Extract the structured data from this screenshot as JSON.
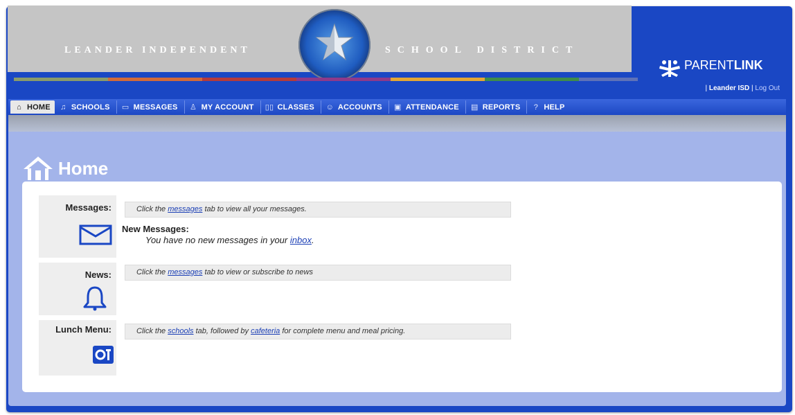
{
  "banner": {
    "left_text": "Leander Independent",
    "right_text": "School District"
  },
  "brand": {
    "name_light": "PARENT",
    "name_bold": "LINK"
  },
  "top_links": {
    "sep": "|",
    "district": "Leander ISD",
    "logout": "Log Out"
  },
  "nav": {
    "tabs": [
      {
        "label": "HOME",
        "icon": "home-icon"
      },
      {
        "label": "SCHOOLS",
        "icon": "bell-icon"
      },
      {
        "label": "MESSAGES",
        "icon": "envelope-icon"
      },
      {
        "label": "MY ACCOUNT",
        "icon": "person-icon"
      },
      {
        "label": "CLASSES",
        "icon": "book-icon"
      },
      {
        "label": "ACCOUNTS",
        "icon": "people-icon"
      },
      {
        "label": "ATTENDANCE",
        "icon": "calendar-icon"
      },
      {
        "label": "REPORTS",
        "icon": "report-icon"
      },
      {
        "label": "HELP",
        "icon": "help-icon"
      }
    ]
  },
  "page": {
    "title": "Home"
  },
  "sections": {
    "messages": {
      "label": "Messages:",
      "hint_pre": "Click the ",
      "hint_link": "messages",
      "hint_post": " tab to view all your messages.",
      "new_title": "New Messages:",
      "new_pre": "You have no new messages in your ",
      "new_link": "inbox",
      "new_post": "."
    },
    "news": {
      "label": "News:",
      "hint_pre": "Click the ",
      "hint_link": "messages",
      "hint_post": " tab to view or subscribe to news"
    },
    "lunch": {
      "label": "Lunch Menu:",
      "hint_pre": "Click the ",
      "hint_link1": "schools",
      "hint_mid": " tab, followed by ",
      "hint_link2": "cafeteria",
      "hint_post": " for complete menu and meal pricing."
    }
  },
  "colors": {
    "frame_blue": "#1a47c4",
    "content_bg": "#a3b4ea",
    "icon_blue": "#1a47c4"
  }
}
